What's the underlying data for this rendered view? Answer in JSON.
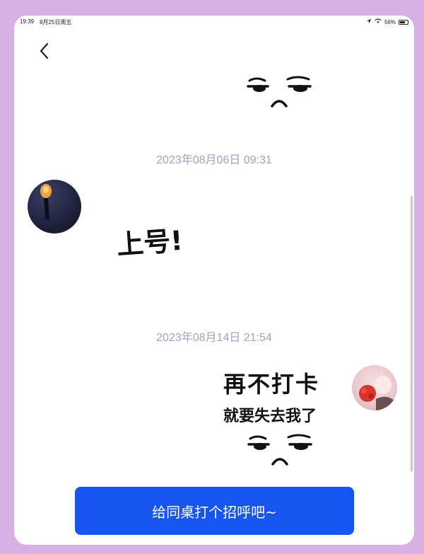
{
  "status_bar": {
    "time": "19:39",
    "date": "8月25日周五",
    "battery": "56%"
  },
  "messages": [
    {
      "timestamp": "2023年08月06日 09:31",
      "sticker_text": "上号!"
    },
    {
      "timestamp": "2023年08月14日 21:54",
      "sticker_line1": "再不打卡",
      "sticker_line2": "就要失去我了"
    }
  ],
  "cta": {
    "label": "给同桌打个招呼吧~"
  },
  "colors": {
    "accent": "#1755f0",
    "frame": "#d8b1e4",
    "timestamp": "#9aa6bd"
  }
}
